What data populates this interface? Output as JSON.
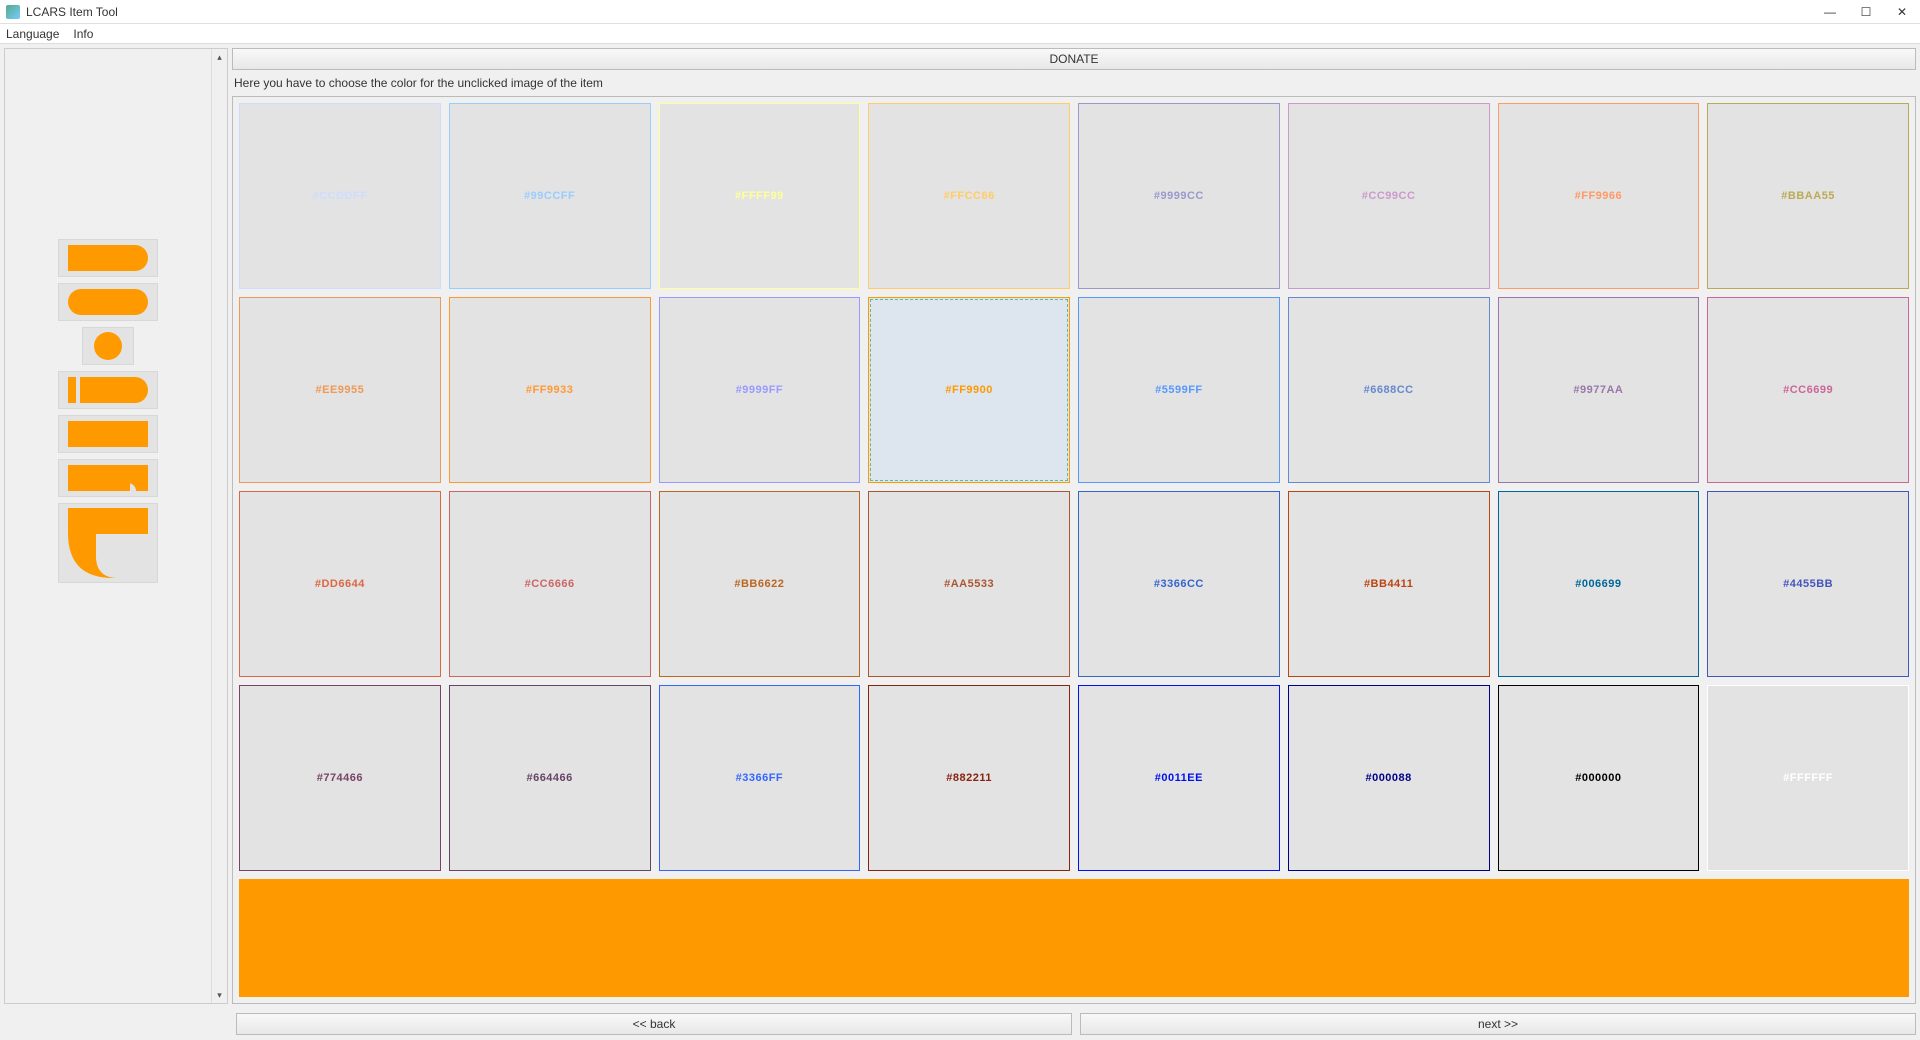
{
  "window": {
    "title": "LCARS Item Tool"
  },
  "menu": {
    "language": "Language",
    "info": "Info"
  },
  "main": {
    "donate": "DONATE",
    "instruction": "Here you have to choose the color for the unclicked image of the item",
    "back": "<< back",
    "next": "next >>"
  },
  "selected_color": "#FF9900",
  "colors": [
    {
      "hex": "#CCDDFF"
    },
    {
      "hex": "#99CCFF"
    },
    {
      "hex": "#FFFF99"
    },
    {
      "hex": "#FFCC66"
    },
    {
      "hex": "#9999CC"
    },
    {
      "hex": "#CC99CC"
    },
    {
      "hex": "#FF9966"
    },
    {
      "hex": "#BBAA55"
    },
    {
      "hex": "#EE9955"
    },
    {
      "hex": "#FF9933"
    },
    {
      "hex": "#9999FF"
    },
    {
      "hex": "#FF9900"
    },
    {
      "hex": "#5599FF"
    },
    {
      "hex": "#6688CC"
    },
    {
      "hex": "#9977AA"
    },
    {
      "hex": "#CC6699"
    },
    {
      "hex": "#DD6644"
    },
    {
      "hex": "#CC6666"
    },
    {
      "hex": "#BB6622"
    },
    {
      "hex": "#AA5533"
    },
    {
      "hex": "#3366CC"
    },
    {
      "hex": "#BB4411"
    },
    {
      "hex": "#006699"
    },
    {
      "hex": "#4455BB"
    },
    {
      "hex": "#774466"
    },
    {
      "hex": "#664466"
    },
    {
      "hex": "#3366FF"
    },
    {
      "hex": "#882211"
    },
    {
      "hex": "#0011EE"
    },
    {
      "hex": "#000088"
    },
    {
      "hex": "#000000"
    },
    {
      "hex": "#FFFFFF"
    }
  ],
  "shapes": [
    {
      "name": "rounded-right"
    },
    {
      "name": "pill"
    },
    {
      "name": "circle"
    },
    {
      "name": "rounded-right-split"
    },
    {
      "name": "rectangle"
    },
    {
      "name": "notched-rect"
    },
    {
      "name": "elbow"
    }
  ]
}
